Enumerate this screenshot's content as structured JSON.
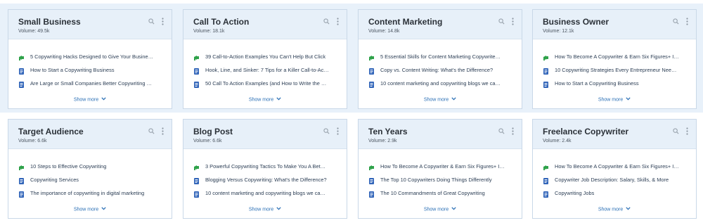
{
  "cards": [
    {
      "title": "Small Business",
      "volume": "Volume: 49.5k",
      "articles": [
        {
          "text": "5 Copywriting Hacks Designed to Give Your Busine…",
          "icon": "megaphone-icon",
          "color": "#2fa24a"
        },
        {
          "text": "How to Start a Copywriting Business",
          "icon": "document-icon",
          "color": "#2f63b8"
        },
        {
          "text": "Are Large or Small Companies Better Copywriting …",
          "icon": "document-icon",
          "color": "#2f63b8"
        }
      ],
      "show_more": "Show more"
    },
    {
      "title": "Call To Action",
      "volume": "Volume: 18.1k",
      "articles": [
        {
          "text": "39 Call-to-Action Examples You Can't Help But Click",
          "icon": "megaphone-icon",
          "color": "#2fa24a"
        },
        {
          "text": "Hook, Line, and Sinker: 7 Tips for a Killer Call-to-Ac…",
          "icon": "document-icon",
          "color": "#2f63b8"
        },
        {
          "text": "50 Call To Action Examples (and How to Write the …",
          "icon": "document-icon",
          "color": "#2f63b8"
        }
      ],
      "show_more": "Show more"
    },
    {
      "title": "Content Marketing",
      "volume": "Volume: 14.8k",
      "articles": [
        {
          "text": "5 Essential Skills for Content Marketing Copywrite…",
          "icon": "megaphone-icon",
          "color": "#2fa24a"
        },
        {
          "text": "Copy vs. Content Writing: What's the Difference?",
          "icon": "document-icon",
          "color": "#2f63b8"
        },
        {
          "text": "10 content marketing and copywriting blogs we ca…",
          "icon": "document-icon",
          "color": "#2f63b8"
        }
      ],
      "show_more": "Show more"
    },
    {
      "title": "Business Owner",
      "volume": "Volume: 12.1k",
      "articles": [
        {
          "text": "How To Become A Copywriter & Earn Six Figures+ I…",
          "icon": "megaphone-icon",
          "color": "#2fa24a"
        },
        {
          "text": "10 Copywriting Strategies Every Entrepreneur Nee…",
          "icon": "document-icon",
          "color": "#2f63b8"
        },
        {
          "text": "How to Start a Copywriting Business",
          "icon": "document-icon",
          "color": "#2f63b8"
        }
      ],
      "show_more": "Show more"
    },
    {
      "title": "Target Audience",
      "volume": "Volume: 6.6k",
      "articles": [
        {
          "text": "10 Steps to Effective Copywriting",
          "icon": "megaphone-icon",
          "color": "#2fa24a"
        },
        {
          "text": "Copywriting Services",
          "icon": "document-icon",
          "color": "#2f63b8"
        },
        {
          "text": "The importance of copywriting in digital marketing",
          "icon": "document-icon",
          "color": "#2f63b8"
        }
      ],
      "show_more": "Show more"
    },
    {
      "title": "Blog Post",
      "volume": "Volume: 6.6k",
      "articles": [
        {
          "text": "3 Powerful Copywriting Tactics To Make You A Bet…",
          "icon": "megaphone-icon",
          "color": "#2fa24a"
        },
        {
          "text": "Blogging Versus Copywriting: What's the Difference?",
          "icon": "document-icon",
          "color": "#2f63b8"
        },
        {
          "text": "10 content marketing and copywriting blogs we ca…",
          "icon": "document-icon",
          "color": "#2f63b8"
        }
      ],
      "show_more": "Show more"
    },
    {
      "title": "Ten Years",
      "volume": "Volume: 2.9k",
      "articles": [
        {
          "text": "How To Become A Copywriter & Earn Six Figures+ I…",
          "icon": "megaphone-icon",
          "color": "#2fa24a"
        },
        {
          "text": "The Top 10 Copywriters Doing Things Differently",
          "icon": "document-icon",
          "color": "#2f63b8"
        },
        {
          "text": "The 10 Commandments of Great Copywriting",
          "icon": "document-icon",
          "color": "#2f63b8"
        }
      ],
      "show_more": "Show more"
    },
    {
      "title": "Freelance Copywriter",
      "volume": "Volume: 2.4k",
      "articles": [
        {
          "text": "How To Become A Copywriter & Earn Six Figures+ I…",
          "icon": "megaphone-icon",
          "color": "#2fa24a"
        },
        {
          "text": "Copywriter Job Description: Salary, Skills, & More",
          "icon": "document-icon",
          "color": "#2f63b8"
        },
        {
          "text": "Copywriting Jobs",
          "icon": "document-icon",
          "color": "#2f63b8"
        }
      ],
      "show_more": "Show more"
    }
  ]
}
